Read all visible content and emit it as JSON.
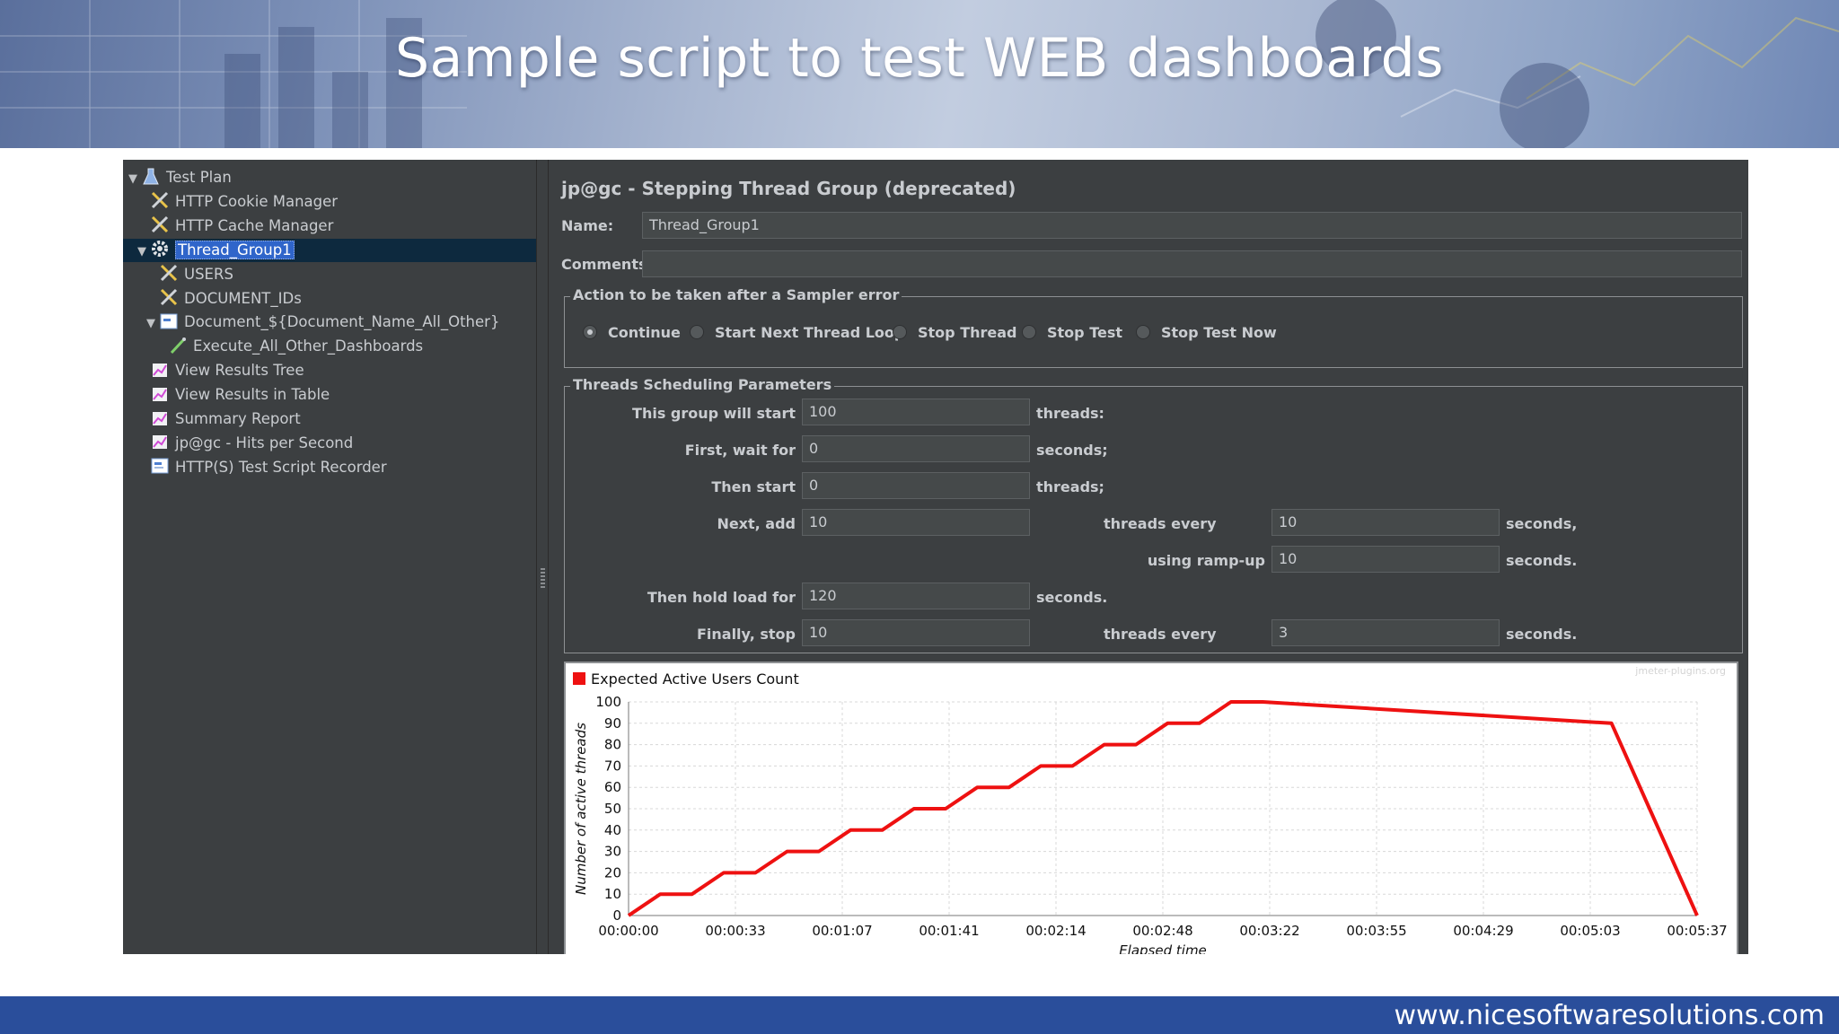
{
  "banner": {
    "title": "Sample script to test WEB dashboards"
  },
  "footer": {
    "url": "www.nicesoftwaresolutions.com"
  },
  "tree": {
    "items": [
      {
        "label": "Test Plan",
        "icon": "flask-icon",
        "indent": 0,
        "expanded": true
      },
      {
        "label": "HTTP Cookie Manager",
        "icon": "tools-icon",
        "indent": 1
      },
      {
        "label": "HTTP Cache Manager",
        "icon": "tools-icon",
        "indent": 1
      },
      {
        "label": "Thread_Group1",
        "icon": "gear-icon",
        "indent": 1,
        "expanded": true,
        "selected": true
      },
      {
        "label": "USERS",
        "icon": "tools-icon",
        "indent": 2
      },
      {
        "label": "DOCUMENT_IDs",
        "icon": "tools-icon",
        "indent": 2
      },
      {
        "label": "Document_${Document_Name_All_Other}",
        "icon": "controller-icon",
        "indent": 2,
        "expanded": true
      },
      {
        "label": "Execute_All_Other_Dashboards",
        "icon": "pipette-icon",
        "indent": 3
      },
      {
        "label": "View Results Tree",
        "icon": "graph-icon",
        "indent": 1
      },
      {
        "label": "View Results in Table",
        "icon": "graph-icon",
        "indent": 1
      },
      {
        "label": "Summary Report",
        "icon": "graph-icon",
        "indent": 1
      },
      {
        "label": "jp@gc - Hits per Second",
        "icon": "graph-icon",
        "indent": 1
      },
      {
        "label": "HTTP(S) Test Script Recorder",
        "icon": "recorder-icon",
        "indent": 1
      }
    ]
  },
  "panel": {
    "title": "jp@gc - Stepping Thread Group (deprecated)",
    "name_label": "Name:",
    "name_value": "Thread_Group1",
    "comments_label": "Comments:",
    "comments_value": "",
    "error_group": {
      "title": "Action to be taken after a Sampler error",
      "options": [
        {
          "label": "Continue",
          "selected": true
        },
        {
          "label": "Start Next Thread Loop",
          "selected": false
        },
        {
          "label": "Stop Thread",
          "selected": false
        },
        {
          "label": "Stop Test",
          "selected": false
        },
        {
          "label": "Stop Test Now",
          "selected": false
        }
      ]
    },
    "sched": {
      "title": "Threads Scheduling Parameters",
      "start_label": "This group will start",
      "start_value": "100",
      "start_unit": "threads:",
      "wait_label": "First, wait for",
      "wait_value": "0",
      "wait_unit": "seconds;",
      "then_label": "Then start",
      "then_value": "0",
      "then_unit": "threads;",
      "next_label": "Next, add",
      "next_value": "10",
      "next_mid": "threads every",
      "next_value2": "10",
      "next_unit": "seconds,",
      "ramp_label": "using ramp-up",
      "ramp_value": "10",
      "ramp_unit": "seconds.",
      "hold_label": "Then hold load for",
      "hold_value": "120",
      "hold_unit": "seconds.",
      "stop_label": "Finally, stop",
      "stop_value": "10",
      "stop_mid": "threads every",
      "stop_value2": "3",
      "stop_unit": "seconds."
    }
  },
  "chart_data": {
    "type": "line",
    "title": "",
    "watermark": "jmeter-plugins.org",
    "legend": "Expected Active Users Count",
    "legend_position": "top-left",
    "xlabel": "Elapsed time",
    "ylabel": "Number of active threads",
    "ylim": [
      0,
      100
    ],
    "xlim_seconds": [
      0,
      337
    ],
    "grid": true,
    "series_color": "#ee1111",
    "x_ticks": [
      "00:00:00",
      "00:00:33",
      "00:01:07",
      "00:01:41",
      "00:02:14",
      "00:02:48",
      "00:03:22",
      "00:03:55",
      "00:04:29",
      "00:05:03",
      "00:05:37"
    ],
    "y_ticks": [
      0,
      10,
      20,
      30,
      40,
      50,
      60,
      70,
      80,
      90,
      100
    ],
    "series": [
      {
        "name": "Expected Active Users Count",
        "x_seconds": [
          0,
          10,
          20,
          30,
          40,
          50,
          60,
          70,
          80,
          90,
          100,
          110,
          120,
          130,
          140,
          150,
          160,
          170,
          180,
          190,
          200,
          310,
          313,
          316,
          319,
          322,
          325,
          328,
          331,
          334,
          337
        ],
        "y": [
          0,
          10,
          10,
          20,
          20,
          30,
          30,
          40,
          40,
          50,
          50,
          60,
          60,
          70,
          70,
          80,
          80,
          90,
          90,
          100,
          100,
          90,
          80,
          70,
          60,
          50,
          40,
          30,
          20,
          10,
          0
        ]
      }
    ]
  }
}
